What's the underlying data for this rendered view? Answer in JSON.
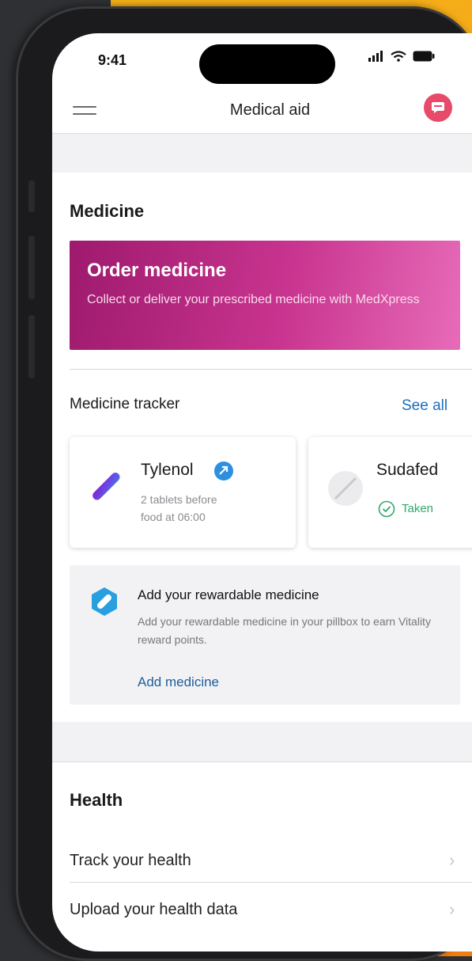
{
  "status_bar": {
    "time": "9:41"
  },
  "app_bar": {
    "title": "Medical aid"
  },
  "medicine": {
    "heading": "Medicine",
    "order_card": {
      "title": "Order medicine",
      "description": "Collect or deliver your prescribed medicine with MedXpress"
    },
    "tracker": {
      "title": "Medicine tracker",
      "see_all": "See all",
      "items": [
        {
          "name": "Tylenol",
          "detail_line1": "2 tablets before",
          "detail_line2": "food at 06:00"
        },
        {
          "name": "Sudafed",
          "status": "Taken"
        }
      ]
    },
    "rewardable": {
      "title": "Add your rewardable medicine",
      "description": "Add your rewardable medicine in your pillbox to earn Vitality reward points.",
      "link": "Add medicine"
    }
  },
  "health": {
    "heading": "Health",
    "rows": [
      {
        "label": "Track your health"
      },
      {
        "label": "Upload your health data"
      }
    ]
  },
  "colors": {
    "accent_pink": "#c8348f",
    "link_blue": "#1e6fb8",
    "chat_red": "#e84a6a",
    "background_orange": "#f39a14"
  }
}
